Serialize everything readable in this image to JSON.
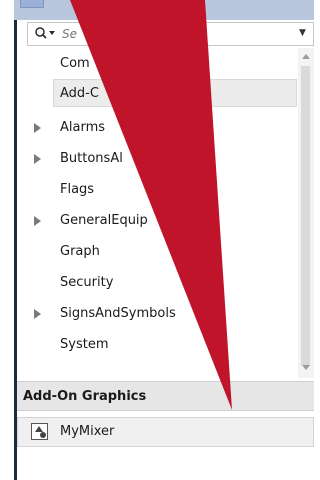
{
  "search": {
    "placeholder": "Se",
    "icon": "search-icon"
  },
  "tree": {
    "items": [
      {
        "label": "Com",
        "expandable": false,
        "selected": false
      },
      {
        "label": "Add-C",
        "expandable": false,
        "selected": true
      },
      {
        "label": "Alarms",
        "expandable": true,
        "selected": false
      },
      {
        "label": "ButtonsAl",
        "expandable": true,
        "selected": false
      },
      {
        "label": "Flags",
        "expandable": false,
        "selected": false
      },
      {
        "label": "GeneralEquip",
        "expandable": true,
        "selected": false
      },
      {
        "label": "Graph",
        "expandable": false,
        "selected": false
      },
      {
        "label": "Security",
        "expandable": false,
        "selected": false
      },
      {
        "label": "SignsAndSymbols",
        "expandable": true,
        "selected": false
      },
      {
        "label": "System",
        "expandable": false,
        "selected": false
      }
    ]
  },
  "section": {
    "title": "Add-On Graphics"
  },
  "graphics": [
    {
      "label": "MyMixer",
      "icon": "mixer-graphic-icon"
    }
  ],
  "colors": {
    "overlay_red": "#c0142b",
    "frame_blue": "#1c2a44",
    "header_blue": "#b9c7de"
  }
}
